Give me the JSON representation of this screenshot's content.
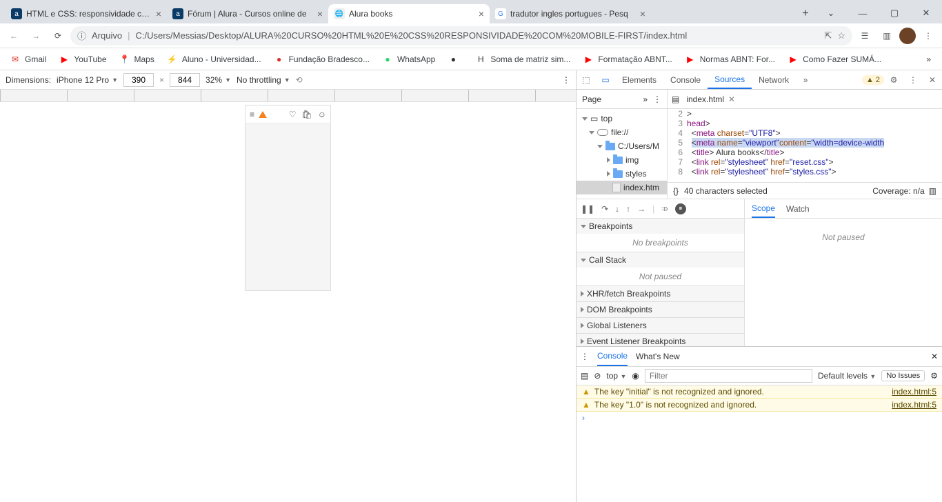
{
  "browser": {
    "tabs": [
      {
        "title": "HTML e CSS: responsividade com",
        "fav_bg": "#0a3b66",
        "fav_txt": "a",
        "fav_color": "#fff"
      },
      {
        "title": "Fórum | Alura - Cursos online de",
        "fav_bg": "#0a3b66",
        "fav_txt": "a",
        "fav_color": "#fff"
      },
      {
        "title": "Alura books",
        "fav_bg": "#eee",
        "fav_txt": "🌐",
        "fav_color": "#666",
        "active": true
      },
      {
        "title": "tradutor ingles portugues - Pesq",
        "fav_bg": "#fff",
        "fav_txt": "G",
        "fav_color": "#4285f4"
      }
    ],
    "win": {
      "dropdown": "⌄",
      "min": "—",
      "max": "▢",
      "close": "✕"
    },
    "url_prefix": "Arquivo",
    "url_path": "C:/Users/Messias/Desktop/ALURA%20CURSO%20HTML%20E%20CSS%20RESPONSIVIDADE%20COM%20MOBILE-FIRST/index.html",
    "bookmarks": [
      {
        "icon": "✉",
        "label": "Gmail",
        "color": "#d93025"
      },
      {
        "icon": "▶",
        "label": "YouTube",
        "color": "#ff0000"
      },
      {
        "icon": "📍",
        "label": "Maps",
        "color": "#34a853"
      },
      {
        "icon": "⚡",
        "label": "Aluno - Universidad...",
        "color": "#fbbc04"
      },
      {
        "icon": "●",
        "label": "Fundação Bradesco...",
        "color": "#d93025"
      },
      {
        "icon": "●",
        "label": "WhatsApp",
        "color": "#25d366"
      },
      {
        "icon": "●",
        "label": "",
        "color": "#333"
      },
      {
        "icon": "H",
        "label": "Soma de matriz sim...",
        "color": "#333"
      },
      {
        "icon": "▶",
        "label": "Formatação ABNT...",
        "color": "#ff0000"
      },
      {
        "icon": "▶",
        "label": "Normas ABNT: For...",
        "color": "#ff0000"
      },
      {
        "icon": "▶",
        "label": "Como Fazer SUMÁ...",
        "color": "#ff0000"
      }
    ]
  },
  "deviceToolbar": {
    "label": "Dimensions:",
    "device": "iPhone 12 Pro",
    "width": "390",
    "height": "844",
    "zoom": "32%",
    "throttle": "No throttling"
  },
  "devtools": {
    "tabs": [
      "Elements",
      "Console",
      "Sources",
      "Network"
    ],
    "activeTab": "Sources",
    "warnCount": "2",
    "navTab": "Page",
    "tree": {
      "root": "top",
      "scheme": "file://",
      "path": "C:/Users/M",
      "folders": [
        "img",
        "styles"
      ],
      "file": "index.htm"
    },
    "editor": {
      "filename": "index.html",
      "status_left": "40 characters selected",
      "status_right": "Coverage: n/a",
      "lines": [
        {
          "n": "2",
          "html": "&gt;"
        },
        {
          "n": "3",
          "html": "<span class='tg'>head</span>&gt;"
        },
        {
          "n": "4",
          "html": "&nbsp;&nbsp;&lt;<span class='tg'>meta</span> <span class='at'>charset</span>=<span class='st'>\"UTF8\"</span>&gt;"
        },
        {
          "n": "5",
          "html": "&nbsp;&nbsp;<span class='hl'>&lt;<span class='tg'>meta</span> <span class='at'>name</span>=<span class='st'>\"viewport\"</span><span class='at'>content</span>=<span class='st'>\"width=device-width</span></span>"
        },
        {
          "n": "6",
          "html": "&nbsp;&nbsp;&lt;<span class='tg'>title</span>&gt; Alura books&lt;/<span class='tg'>title</span>&gt;"
        },
        {
          "n": "7",
          "html": "&nbsp;&nbsp;&lt;<span class='tg'>link</span> <span class='at'>rel</span>=<span class='st'>\"stylesheet\"</span> <span class='at'>href</span>=<span class='st'>\"reset.css\"</span>&gt;"
        },
        {
          "n": "8",
          "html": "&nbsp;&nbsp;&lt;<span class='tg'>link</span> <span class='at'>rel</span>=<span class='st'>\"stylesheet\"</span> <span class='at'>href</span>=<span class='st'>\"styles.css\"</span>&gt;"
        }
      ]
    },
    "scopeTabs": [
      "Scope",
      "Watch"
    ],
    "notPaused": "Not paused",
    "bpSections": [
      {
        "title": "Breakpoints",
        "open": true,
        "content": "No breakpoints"
      },
      {
        "title": "Call Stack",
        "open": true,
        "content": "Not paused"
      },
      {
        "title": "XHR/fetch Breakpoints",
        "open": false
      },
      {
        "title": "DOM Breakpoints",
        "open": false
      },
      {
        "title": "Global Listeners",
        "open": false
      },
      {
        "title": "Event Listener Breakpoints",
        "open": false
      }
    ]
  },
  "console": {
    "tabs": [
      "Console",
      "What's New"
    ],
    "filterPlaceholder": "Filter",
    "context": "top",
    "levels": "Default levels",
    "noIssues": "No Issues",
    "msgs": [
      {
        "text": "The key \"initial\" is not recognized and ignored.",
        "link": "index.html:5"
      },
      {
        "text": "The key \"1.0\" is not recognized and ignored.",
        "link": "index.html:5"
      }
    ]
  }
}
